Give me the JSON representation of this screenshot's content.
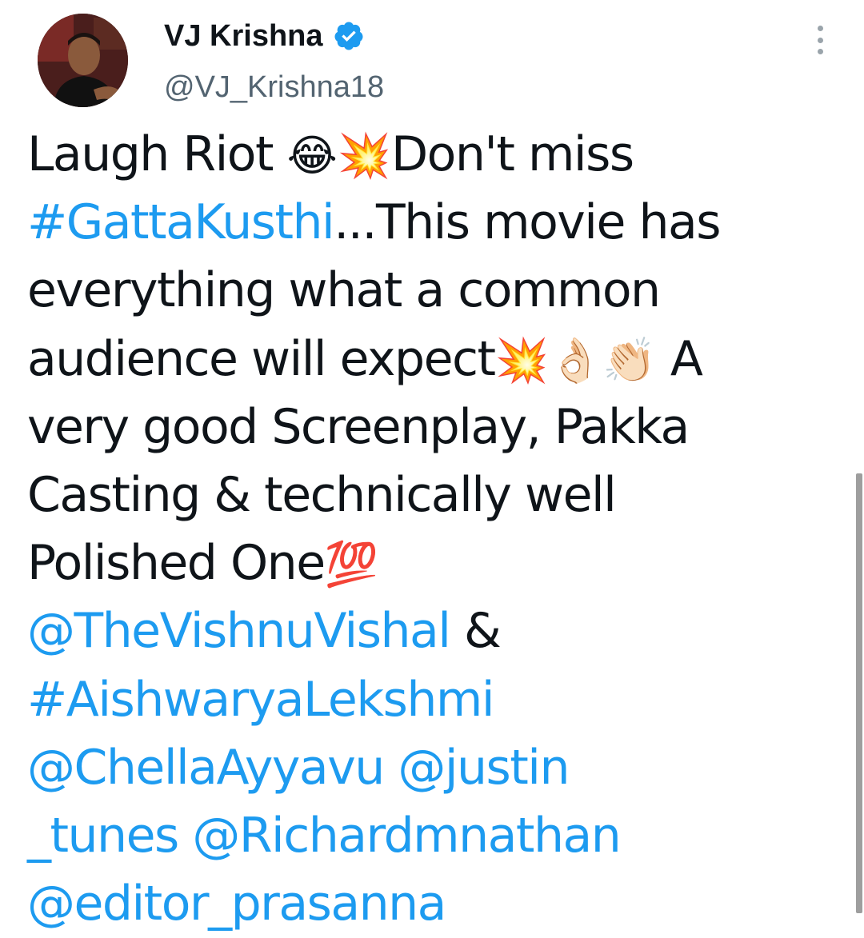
{
  "user": {
    "display_name": "VJ Krishna",
    "handle": "@VJ_Krishna18",
    "verified": true
  },
  "more_icon": "more-vertical-icon",
  "tweet": {
    "lines": [
      [
        {
          "t": "text",
          "v": "Laugh Riot "
        },
        {
          "t": "emoji",
          "v": "😂"
        },
        {
          "t": "emoji",
          "v": "💥"
        },
        {
          "t": "text",
          "v": "Don't miss"
        }
      ],
      [
        {
          "t": "link",
          "v": "#GattaKusthi"
        },
        {
          "t": "text",
          "v": "...This movie has"
        }
      ],
      [
        {
          "t": "text",
          "v": "everything what a common"
        }
      ],
      [
        {
          "t": "text",
          "v": "audience will expect"
        },
        {
          "t": "emoji",
          "v": "💥"
        },
        {
          "t": "emoji",
          "v": "👌🏻"
        },
        {
          "t": "emoji",
          "v": "👏🏻"
        },
        {
          "t": "text",
          "v": " A"
        }
      ],
      [
        {
          "t": "text",
          "v": "very good Screenplay, Pakka"
        }
      ],
      [
        {
          "t": "text",
          "v": "Casting & technically well"
        }
      ],
      [
        {
          "t": "text",
          "v": "Polished One"
        },
        {
          "t": "emoji",
          "v": "💯"
        }
      ],
      [
        {
          "t": "link",
          "v": "@TheVishnuVishal"
        },
        {
          "t": "text",
          "v": " &"
        }
      ],
      [
        {
          "t": "link",
          "v": "#AishwaryaLekshmi"
        }
      ],
      [
        {
          "t": "link",
          "v": "@ChellaAyyavu"
        },
        {
          "t": "text",
          "v": "  "
        },
        {
          "t": "link",
          "v": "@justin"
        }
      ],
      [
        {
          "t": "link",
          "v": "_tunes"
        },
        {
          "t": "text",
          "v": " "
        },
        {
          "t": "link",
          "v": "@Richardmnathan"
        }
      ],
      [
        {
          "t": "link",
          "v": "@editor_prasanna"
        }
      ]
    ]
  },
  "colors": {
    "link": "#1d9bf0",
    "text": "#0f1419",
    "handle": "#536471",
    "verified": "#1d9bf0"
  }
}
